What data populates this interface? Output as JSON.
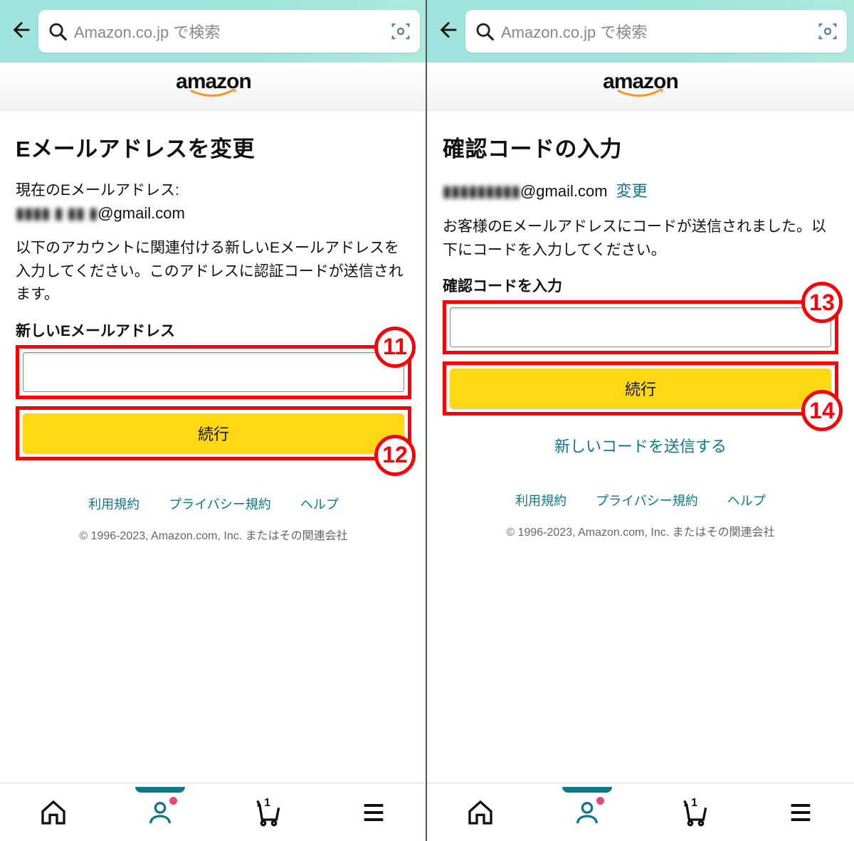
{
  "search_placeholder": "Amazon.co.jp で検索",
  "brand": "amazon",
  "footer": {
    "terms": "利用規約",
    "privacy": "プライバシー規約",
    "help": "ヘルプ",
    "copyright": "© 1996-2023, Amazon.com, Inc. またはその関連会社"
  },
  "bottomnav": {
    "cart_count": "1"
  },
  "left": {
    "title": "Eメールアドレスを変更",
    "current_label": "現在のEメールアドレス:",
    "current_email_blur": "▮▮▮▮ ▮ ▮▮ ▮",
    "current_email_domain": "@gmail.com",
    "instruction": "以下のアカウントに関連付ける新しいEメールアドレスを入力してください。このアドレスに認証コードが送信されます。",
    "field_label": "新しいEメールアドレス",
    "button": "続行",
    "badge_input": "11",
    "badge_button": "12"
  },
  "right": {
    "title": "確認コードの入力",
    "email_blur": "▮▮▮▮▮▮▮▮▮",
    "email_domain": "@gmail.com",
    "change_link": "変更",
    "instruction": "お客様のEメールアドレスにコードが送信されました。以下にコードを入力してください。",
    "field_label": "確認コードを入力",
    "button": "続行",
    "resend": "新しいコードを送信する",
    "badge_input": "13",
    "badge_button": "14"
  }
}
